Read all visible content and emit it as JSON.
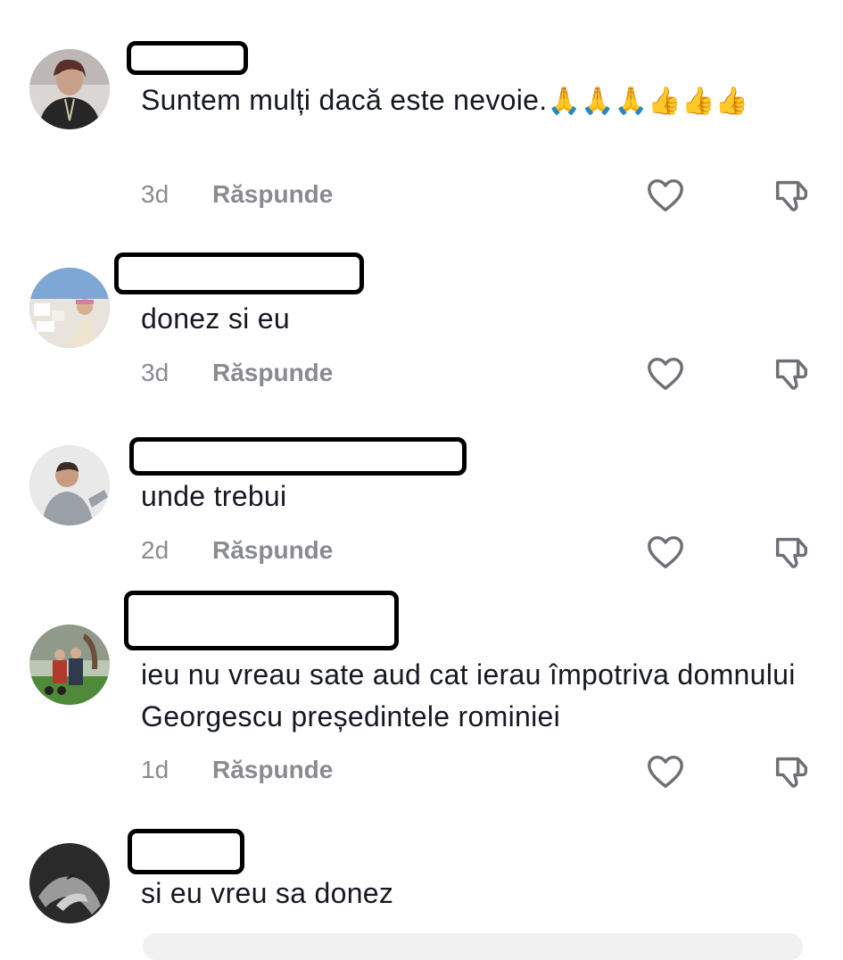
{
  "comments": [
    {
      "text": "Suntem mulți dacă este nevoie.",
      "emoji": "🙏🙏🙏👍👍👍",
      "time": "3d",
      "reply_label": "Răspunde"
    },
    {
      "text": "donez si eu",
      "time": "3d",
      "reply_label": "Răspunde"
    },
    {
      "text": "unde trebui",
      "time": "2d",
      "reply_label": "Răspunde"
    },
    {
      "text": "ieu nu vreau sate aud cat ierau împotriva domnului Georgescu președintele rominiei",
      "time": "1d",
      "reply_label": "Răspunde"
    },
    {
      "text": "si eu vreu sa donez"
    }
  ],
  "icons": {
    "like": "heart-outline-icon",
    "dislike": "thumbs-down-outline-icon"
  },
  "colors": {
    "text": "#161823",
    "muted": "#8a8b91",
    "redaction_border": "#000000"
  }
}
